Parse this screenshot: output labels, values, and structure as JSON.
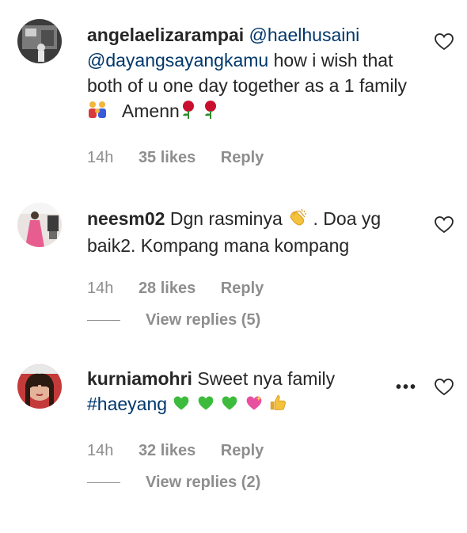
{
  "comments": [
    {
      "username": "angelaelizarampai",
      "mentions": [
        "@haelhusaini",
        "@dayangsayangkamu"
      ],
      "text_part1": "how i wish that both of u one day together as a 1 family",
      "text_part2": "Amenn",
      "time": "14h",
      "likes": "35 likes",
      "reply": "Reply",
      "icons": [
        "family-emoji",
        "rose-emoji",
        "rose-emoji"
      ]
    },
    {
      "username": "neesm02",
      "text_part1": "Dgn rasminya",
      "text_part2": ". Doa yg baik2. Kompang mana kompang",
      "time": "14h",
      "likes": "28 likes",
      "reply": "Reply",
      "view_replies": "View replies (5)",
      "icons": [
        "clapping-hands-emoji"
      ]
    },
    {
      "username": "kurniamohri",
      "text_part1": "Sweet nya family",
      "hashtag": "#haeyang",
      "time": "14h",
      "likes": "32 likes",
      "reply": "Reply",
      "view_replies": "View replies (2)",
      "more": "•••",
      "icons": [
        "green-heart-emoji",
        "green-heart-emoji",
        "green-heart-emoji",
        "sparkling-heart-emoji",
        "thumbs-up-emoji"
      ]
    }
  ],
  "colors": {
    "mention": "#00376b",
    "meta": "#8e8e8e",
    "text": "#262626"
  }
}
